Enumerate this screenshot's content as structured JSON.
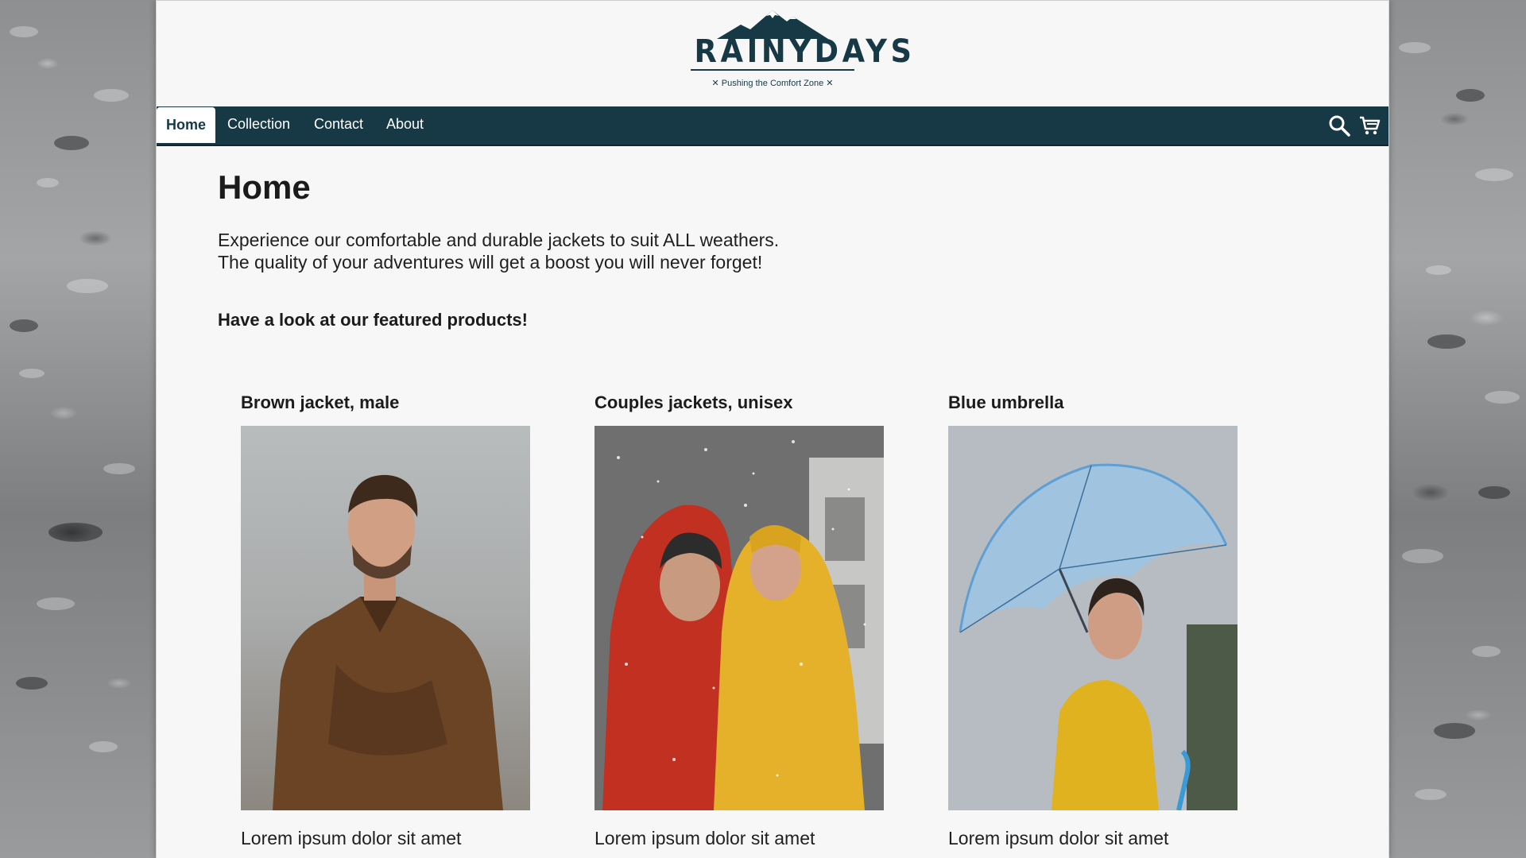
{
  "brand": {
    "name": "RAINYDAYS",
    "tagline": "✕ Pushing the Comfort Zone ✕"
  },
  "nav": {
    "items": [
      {
        "label": "Home",
        "active": true
      },
      {
        "label": "Collection",
        "active": false
      },
      {
        "label": "Contact",
        "active": false
      },
      {
        "label": "About",
        "active": false
      }
    ],
    "icons": [
      "search-icon",
      "cart-icon"
    ]
  },
  "main": {
    "title": "Home",
    "intro_line1": "Experience our comfortable and durable jackets to suit ALL weathers.",
    "intro_line2": "The quality of your adventures will get a boost you will never forget!",
    "featured_heading": "Have a look at our featured products!"
  },
  "products": [
    {
      "title": "Brown jacket, male",
      "description": "Lorem ipsum dolor sit amet"
    },
    {
      "title": "Couples jackets, unisex",
      "description": "Lorem ipsum dolor sit amet"
    },
    {
      "title": "Blue umbrella",
      "description": "Lorem ipsum dolor sit amet"
    }
  ],
  "colors": {
    "brand_dark": "#173845",
    "page_bg": "#f7f7f7",
    "text": "#1b1b1b"
  }
}
